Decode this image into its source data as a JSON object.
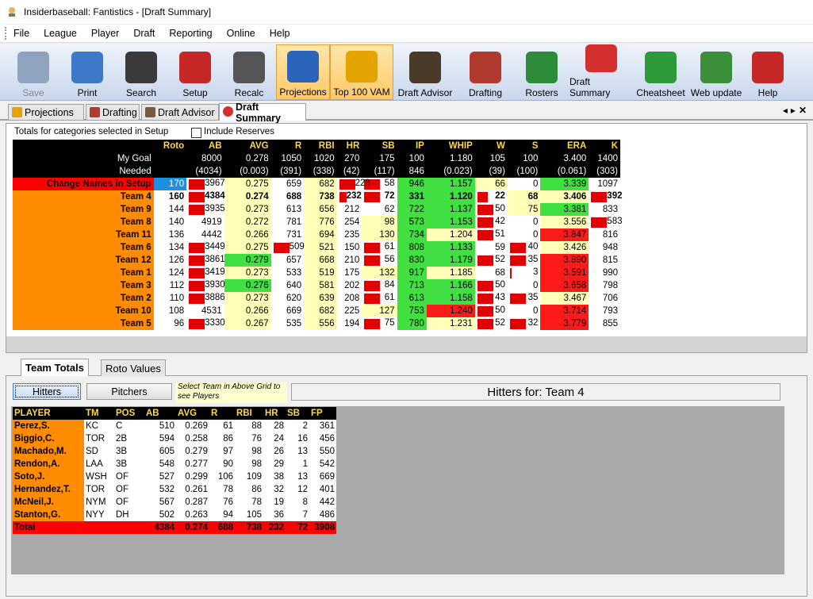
{
  "window": {
    "title": "Insiderbaseball: Fantistics - [Draft Summary]"
  },
  "menu": [
    "File",
    "League",
    "Player",
    "Draft",
    "Reporting",
    "Online",
    "Help"
  ],
  "toolbar": [
    {
      "label": "Save",
      "icon": "floppy-disk-icon",
      "color": "#8fa3bf",
      "disabled": true
    },
    {
      "label": "Print",
      "icon": "printer-icon",
      "color": "#3d78c9"
    },
    {
      "label": "Search",
      "icon": "binoculars-icon",
      "color": "#3a3a3a"
    },
    {
      "label": "Setup",
      "icon": "toolbox-icon",
      "color": "#c62828"
    },
    {
      "label": "Recalc",
      "icon": "calculator-icon",
      "color": "#555"
    },
    {
      "label": "Projections",
      "icon": "umpire-icon",
      "color": "#2b64b8",
      "active": true
    },
    {
      "label": "Top 100 VAM",
      "icon": "trophy-icon",
      "color": "#e3a400",
      "active": true
    },
    {
      "label": "Draft Advisor",
      "icon": "graduate-icon",
      "color": "#4a3a2a"
    },
    {
      "label": "Drafting",
      "icon": "draft-board-icon",
      "color": "#b03a2e"
    },
    {
      "label": "Rosters",
      "icon": "checklist-icon",
      "color": "#2e8b3a"
    },
    {
      "label": "Draft Summary",
      "icon": "target-icon",
      "color": "#d32f2f"
    },
    {
      "label": "Cheatsheet",
      "icon": "grade-a-plus-icon",
      "color": "#2e9a3a"
    },
    {
      "label": "Web update",
      "icon": "globe-update-icon",
      "color": "#3b8f3b"
    },
    {
      "label": "Help",
      "icon": "help-book-icon",
      "color": "#c62828"
    }
  ],
  "doc_tabs": [
    "Projections",
    "Drafting",
    "Draft Advisor",
    "Draft Summary"
  ],
  "upper": {
    "caption": "Totals for categories selected in Setup",
    "include_reserves": "Include Reserves",
    "columns": [
      "Roto",
      "AB",
      "AVG",
      "R",
      "RBI",
      "HR",
      "SB",
      "IP",
      "WHIP",
      "W",
      "S",
      "ERA",
      "K"
    ],
    "my_goal_label": "My Goal",
    "needed_label": "Needed",
    "my_goal": [
      "",
      "8000",
      "0.278",
      "1050",
      "1020",
      "270",
      "175",
      "100",
      "1.180",
      "105",
      "100",
      "3.400",
      "1400"
    ],
    "needed": [
      "",
      "(4034)",
      "(0.003)",
      "(391)",
      "(338)",
      "(42)",
      "(117)",
      "846",
      "(0.023)",
      "(39)",
      "(100)",
      "(0.061)",
      "(303)"
    ],
    "rows": [
      {
        "name": "Change Names in Setup",
        "vals": [
          "170",
          "3967",
          "0.275",
          "659",
          "682",
          "228",
          "58",
          "946",
          "1.157",
          "66",
          "0",
          "3.339",
          "1097"
        ]
      },
      {
        "name": "Team 4",
        "vals": [
          "160",
          "4384",
          "0.274",
          "688",
          "738",
          "232",
          "72",
          "331",
          "1.120",
          "22",
          "68",
          "3.406",
          "392"
        ]
      },
      {
        "name": "Team 9",
        "vals": [
          "144",
          "3935",
          "0.273",
          "613",
          "656",
          "212",
          "62",
          "722",
          "1.137",
          "50",
          "75",
          "3.381",
          "833"
        ]
      },
      {
        "name": "Team 8",
        "vals": [
          "140",
          "4919",
          "0.272",
          "781",
          "776",
          "254",
          "98",
          "573",
          "1.153",
          "42",
          "0",
          "3.556",
          "583"
        ]
      },
      {
        "name": "Team 11",
        "vals": [
          "136",
          "4442",
          "0.266",
          "731",
          "694",
          "235",
          "130",
          "734",
          "1.204",
          "51",
          "0",
          "3.847",
          "816"
        ]
      },
      {
        "name": "Team 6",
        "vals": [
          "134",
          "3449",
          "0.275",
          "509",
          "521",
          "150",
          "61",
          "808",
          "1.133",
          "59",
          "40",
          "3.426",
          "948"
        ]
      },
      {
        "name": "Team 12",
        "vals": [
          "126",
          "3861",
          "0.279",
          "657",
          "668",
          "210",
          "56",
          "830",
          "1.179",
          "52",
          "35",
          "3.890",
          "815"
        ]
      },
      {
        "name": "Team 1",
        "vals": [
          "124",
          "3419",
          "0.273",
          "533",
          "519",
          "175",
          "132",
          "917",
          "1.185",
          "68",
          "3",
          "3.591",
          "990"
        ]
      },
      {
        "name": "Team 3",
        "vals": [
          "112",
          "3930",
          "0.276",
          "640",
          "581",
          "202",
          "84",
          "713",
          "1.166",
          "50",
          "0",
          "3.658",
          "798"
        ]
      },
      {
        "name": "Team 2",
        "vals": [
          "110",
          "3886",
          "0.273",
          "620",
          "639",
          "208",
          "61",
          "613",
          "1.158",
          "43",
          "35",
          "3.467",
          "706"
        ]
      },
      {
        "name": "Team 10",
        "vals": [
          "108",
          "4531",
          "0.266",
          "669",
          "682",
          "225",
          "127",
          "753",
          "1.240",
          "50",
          "0",
          "3.714",
          "793"
        ]
      },
      {
        "name": "Team 5",
        "vals": [
          "96",
          "3330",
          "0.267",
          "535",
          "556",
          "194",
          "75",
          "780",
          "1.231",
          "52",
          "32",
          "3.779",
          "855"
        ]
      }
    ]
  },
  "lower_tabs": [
    "Team Totals",
    "Roto Values"
  ],
  "lower": {
    "hitters_btn": "Hitters",
    "pitchers_btn": "Pitchers",
    "hint": "Select Team in Above Grid to see Players",
    "hitters_for": "Hitters for: Team 4",
    "columns": [
      "PLAYER",
      "TM",
      "POS",
      "AB",
      "AVG",
      "R",
      "RBI",
      "HR",
      "SB",
      "FP"
    ],
    "players": [
      [
        "Perez,S.",
        "KC",
        "C",
        "510",
        "0.269",
        "61",
        "88",
        "28",
        "2",
        "361"
      ],
      [
        "Biggio,C.",
        "TOR",
        "2B",
        "594",
        "0.258",
        "86",
        "76",
        "24",
        "16",
        "456"
      ],
      [
        "Machado,M.",
        "SD",
        "3B",
        "605",
        "0.279",
        "97",
        "98",
        "26",
        "13",
        "550"
      ],
      [
        "Rendon,A.",
        "LAA",
        "3B",
        "548",
        "0.277",
        "90",
        "98",
        "29",
        "1",
        "542"
      ],
      [
        "Soto,J.",
        "WSH",
        "OF",
        "527",
        "0.299",
        "106",
        "109",
        "38",
        "13",
        "669"
      ],
      [
        "Hernandez,T.",
        "TOR",
        "OF",
        "532",
        "0.261",
        "78",
        "86",
        "32",
        "12",
        "401"
      ],
      [
        "McNeil,J.",
        "NYM",
        "OF",
        "567",
        "0.287",
        "76",
        "78",
        "19",
        "8",
        "442"
      ],
      [
        "Stanton,G.",
        "NYY",
        "DH",
        "502",
        "0.263",
        "94",
        "105",
        "36",
        "7",
        "486"
      ]
    ],
    "total": [
      "Total",
      "",
      "",
      "4384",
      "0.274",
      "688",
      "738",
      "232",
      "72",
      "3908"
    ]
  }
}
